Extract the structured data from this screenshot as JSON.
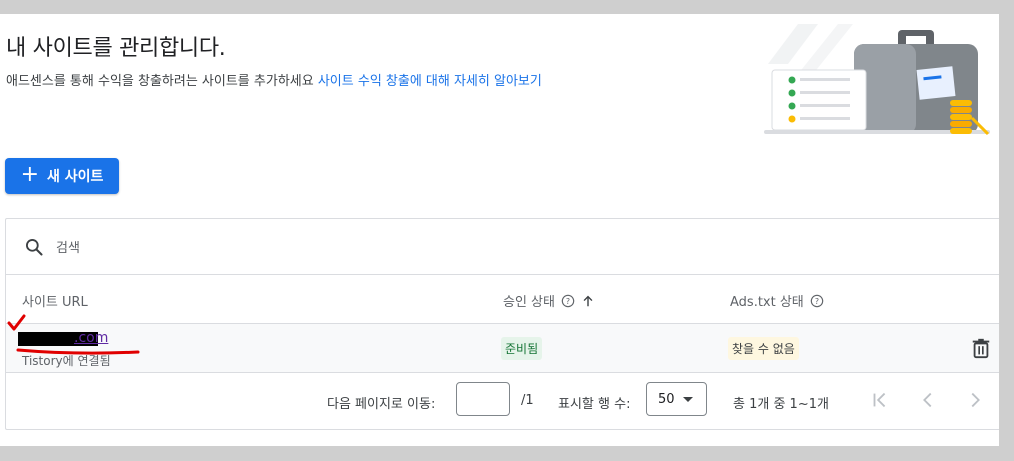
{
  "header": {
    "title": "내 사이트를 관리합니다.",
    "description": "애드센스를 통해 수익을 창출하려는 사이트를 추가하세요",
    "learn_more_link": "사이트 수익 창출에 대해 자세히 알아보기"
  },
  "actions": {
    "new_site_label": "새 사이트"
  },
  "search": {
    "placeholder": "검색",
    "icon": "search-icon"
  },
  "table": {
    "columns": {
      "site_url": "사이트 URL",
      "approval_status": "승인 상태",
      "ads_txt_status": "Ads.txt 상태"
    },
    "rows": [
      {
        "site_url_visible": ".com",
        "connection": "Tistory에 연결됨",
        "approval_status": "준비됨",
        "ads_txt_status": "찾을 수 없음"
      }
    ]
  },
  "pagination": {
    "goto_label": "다음 페이지로 이동:",
    "page_total": "/1",
    "rows_label": "표시할 행 수:",
    "rows_value": "50",
    "range_text": "총 1개 중 1~1개"
  },
  "colors": {
    "accent": "#1a73e8",
    "ready_badge_bg": "#e6f4ea",
    "notfound_badge_bg": "#fef7e0",
    "annotation_red": "#e00000"
  }
}
